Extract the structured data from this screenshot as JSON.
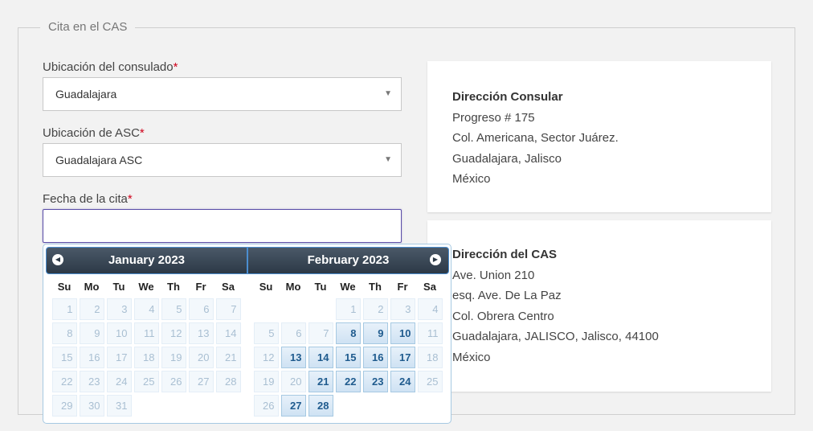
{
  "form": {
    "legend": "Cita en el CAS",
    "consulado_label": "Ubicación del consulado",
    "consulado_value": "Guadalajara",
    "asc_label": "Ubicación de ASC",
    "asc_value": "Guadalajara ASC",
    "fecha_label": "Fecha de la cita",
    "fecha_value": "",
    "required_mark": "*",
    "caret": "▼"
  },
  "consular_card": {
    "title": "Dirección Consular",
    "lines": [
      "Progreso # 175",
      "Col. Americana, Sector Juárez.",
      "Guadalajara, Jalisco",
      "México"
    ]
  },
  "cas_card": {
    "title": "Dirección del CAS",
    "lines": [
      "Ave. Union 210",
      "esq. Ave. De La Paz",
      "Col. Obrera Centro",
      "Guadalajara, JALISCO, Jalisco, 44100",
      "México"
    ]
  },
  "datepicker": {
    "prev_icon": "◀",
    "next_icon": "▶",
    "weekdays": [
      "Su",
      "Mo",
      "Tu",
      "We",
      "Th",
      "Fr",
      "Sa"
    ],
    "months": [
      {
        "title": "January 2023",
        "weeks": [
          [
            {
              "d": "1",
              "s": "disabled"
            },
            {
              "d": "2",
              "s": "disabled"
            },
            {
              "d": "3",
              "s": "disabled"
            },
            {
              "d": "4",
              "s": "disabled"
            },
            {
              "d": "5",
              "s": "disabled"
            },
            {
              "d": "6",
              "s": "disabled"
            },
            {
              "d": "7",
              "s": "disabled"
            }
          ],
          [
            {
              "d": "8",
              "s": "disabled"
            },
            {
              "d": "9",
              "s": "disabled"
            },
            {
              "d": "10",
              "s": "disabled"
            },
            {
              "d": "11",
              "s": "disabled"
            },
            {
              "d": "12",
              "s": "disabled"
            },
            {
              "d": "13",
              "s": "disabled"
            },
            {
              "d": "14",
              "s": "disabled"
            }
          ],
          [
            {
              "d": "15",
              "s": "disabled"
            },
            {
              "d": "16",
              "s": "disabled"
            },
            {
              "d": "17",
              "s": "disabled"
            },
            {
              "d": "18",
              "s": "disabled"
            },
            {
              "d": "19",
              "s": "disabled"
            },
            {
              "d": "20",
              "s": "disabled"
            },
            {
              "d": "21",
              "s": "disabled"
            }
          ],
          [
            {
              "d": "22",
              "s": "disabled"
            },
            {
              "d": "23",
              "s": "disabled"
            },
            {
              "d": "24",
              "s": "disabled"
            },
            {
              "d": "25",
              "s": "disabled"
            },
            {
              "d": "26",
              "s": "disabled"
            },
            {
              "d": "27",
              "s": "disabled"
            },
            {
              "d": "28",
              "s": "disabled"
            }
          ],
          [
            {
              "d": "29",
              "s": "disabled"
            },
            {
              "d": "30",
              "s": "disabled"
            },
            {
              "d": "31",
              "s": "disabled"
            },
            {
              "d": "",
              "s": "empty"
            },
            {
              "d": "",
              "s": "empty"
            },
            {
              "d": "",
              "s": "empty"
            },
            {
              "d": "",
              "s": "empty"
            }
          ]
        ]
      },
      {
        "title": "February 2023",
        "weeks": [
          [
            {
              "d": "",
              "s": "empty"
            },
            {
              "d": "",
              "s": "empty"
            },
            {
              "d": "",
              "s": "empty"
            },
            {
              "d": "1",
              "s": "disabled"
            },
            {
              "d": "2",
              "s": "disabled"
            },
            {
              "d": "3",
              "s": "disabled"
            },
            {
              "d": "4",
              "s": "disabled"
            }
          ],
          [
            {
              "d": "5",
              "s": "disabled"
            },
            {
              "d": "6",
              "s": "disabled"
            },
            {
              "d": "7",
              "s": "disabled"
            },
            {
              "d": "8",
              "s": "active"
            },
            {
              "d": "9",
              "s": "active"
            },
            {
              "d": "10",
              "s": "active"
            },
            {
              "d": "11",
              "s": "disabled"
            }
          ],
          [
            {
              "d": "12",
              "s": "disabled"
            },
            {
              "d": "13",
              "s": "active"
            },
            {
              "d": "14",
              "s": "active"
            },
            {
              "d": "15",
              "s": "active"
            },
            {
              "d": "16",
              "s": "active"
            },
            {
              "d": "17",
              "s": "active"
            },
            {
              "d": "18",
              "s": "disabled"
            }
          ],
          [
            {
              "d": "19",
              "s": "disabled"
            },
            {
              "d": "20",
              "s": "disabled"
            },
            {
              "d": "21",
              "s": "active"
            },
            {
              "d": "22",
              "s": "active"
            },
            {
              "d": "23",
              "s": "active"
            },
            {
              "d": "24",
              "s": "active"
            },
            {
              "d": "25",
              "s": "disabled"
            }
          ],
          [
            {
              "d": "26",
              "s": "disabled"
            },
            {
              "d": "27",
              "s": "active"
            },
            {
              "d": "28",
              "s": "active"
            },
            {
              "d": "",
              "s": "empty"
            },
            {
              "d": "",
              "s": "empty"
            },
            {
              "d": "",
              "s": "empty"
            },
            {
              "d": "",
              "s": "empty"
            }
          ]
        ]
      }
    ]
  }
}
